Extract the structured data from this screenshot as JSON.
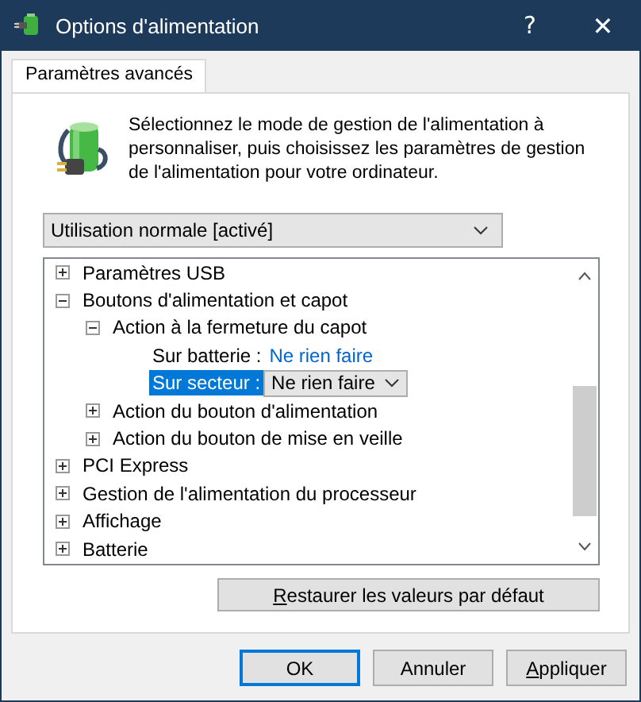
{
  "window": {
    "title": "Options d'alimentation",
    "help": "?",
    "close": "✕"
  },
  "tabs": [
    {
      "label": "Paramètres avancés",
      "selected": true
    }
  ],
  "description": "Sélectionnez le mode de gestion de l'alimentation à personnaliser, puis choisissez les paramètres de gestion de l'alimentation pour votre ordinateur.",
  "plan_dropdown": {
    "value": "Utilisation normale [activé]"
  },
  "tree": [
    {
      "kind": "group",
      "label": "Paramètres USB",
      "expanded": false
    },
    {
      "kind": "group",
      "label": "Boutons d'alimentation et capot",
      "expanded": true,
      "children": [
        {
          "kind": "group",
          "label": "Action à la fermeture du capot",
          "expanded": true,
          "children": [
            {
              "kind": "setting",
              "label": "Sur batterie :",
              "value": "Ne rien faire",
              "selected": false
            },
            {
              "kind": "setting",
              "label": "Sur secteur :",
              "value": "Ne rien faire",
              "selected": true
            }
          ]
        },
        {
          "kind": "group",
          "label": "Action du bouton d'alimentation",
          "expanded": false
        },
        {
          "kind": "group",
          "label": "Action du bouton de mise en veille",
          "expanded": false
        }
      ]
    },
    {
      "kind": "group",
      "label": "PCI Express",
      "expanded": false
    },
    {
      "kind": "group",
      "label": "Gestion de l'alimentation du processeur",
      "expanded": false
    },
    {
      "kind": "group",
      "label": "Affichage",
      "expanded": false
    },
    {
      "kind": "group",
      "label": "Batterie",
      "expanded": false
    }
  ],
  "restore_button": {
    "label": "Restaurer les valeurs par défaut",
    "mnemonic_underlined": true
  },
  "buttons": [
    {
      "label": "OK",
      "default": true,
      "mnemonic_underlined": false
    },
    {
      "label": "Annuler",
      "default": false,
      "mnemonic_underlined": false
    },
    {
      "label": "Appliquer",
      "default": false,
      "mnemonic_underlined": true
    }
  ]
}
